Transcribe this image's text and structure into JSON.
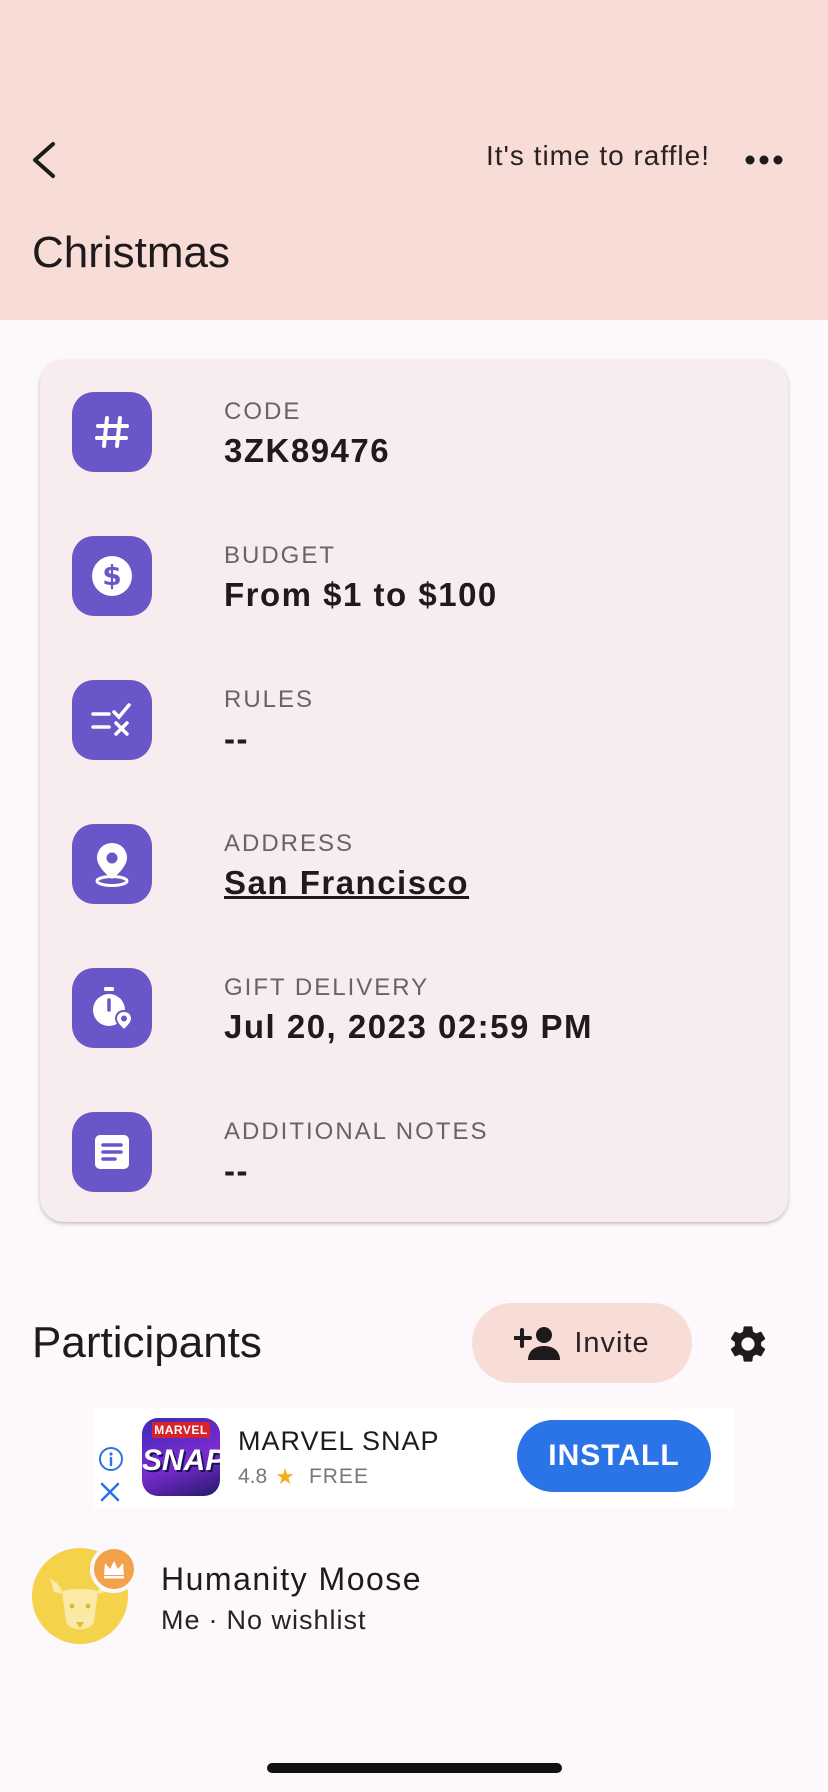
{
  "header": {
    "raffle_action": "It's time to raffle!",
    "title": "Christmas",
    "back_icon": "chevron-left-icon",
    "more_icon": "more-horizontal-icon"
  },
  "details": {
    "code": {
      "label": "CODE",
      "value": "3ZK89476",
      "icon": "hash-icon"
    },
    "budget": {
      "label": "BUDGET",
      "value": "From $1 to $100",
      "icon": "dollar-icon"
    },
    "rules": {
      "label": "RULES",
      "value": "--",
      "icon": "rules-icon"
    },
    "address": {
      "label": "ADDRESS",
      "value": "San Francisco",
      "icon": "location-icon"
    },
    "gift_delivery": {
      "label": "GIFT DELIVERY",
      "value": "Jul 20, 2023 02:59 PM",
      "icon": "timer-location-icon"
    },
    "notes": {
      "label": "ADDITIONAL NOTES",
      "value": "--",
      "icon": "notes-icon"
    }
  },
  "participants": {
    "title": "Participants",
    "invite_label": "Invite",
    "settings_icon": "gear-icon",
    "list": [
      {
        "name": "Humanity Moose",
        "role": "Me",
        "separator": "·",
        "wishlist": "No wishlist"
      }
    ]
  },
  "ad": {
    "app_name": "MARVEL SNAP",
    "rating": "4.8",
    "price": "FREE",
    "install_label": "INSTALL",
    "icon_top_text": "MARVEL",
    "icon_main_text": "SNAP"
  },
  "colors": {
    "header_bg": "#f8dcd6",
    "card_bg": "#f7ecef",
    "icon_bg": "#6a55c9",
    "install_bg": "#2b74e8",
    "avatar_bg": "#f4d24a"
  }
}
